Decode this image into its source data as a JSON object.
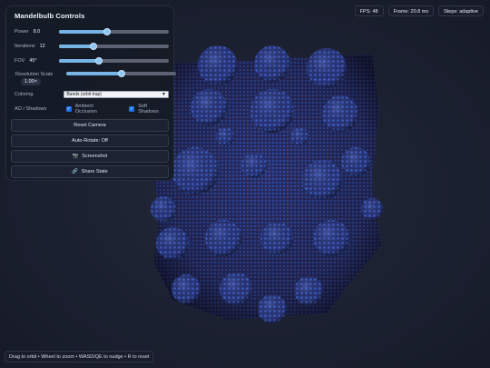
{
  "panel": {
    "title": "Mandelbulb Controls",
    "power": {
      "label": "Power",
      "value": "8.0",
      "fraction": 0.44
    },
    "iterations": {
      "label": "Iterations",
      "value": "12",
      "fraction": 0.31
    },
    "fov": {
      "label": "FOV",
      "value": "45°",
      "fraction": 0.36
    },
    "resolution": {
      "label": "Resolution Scale",
      "value": "1.00×",
      "fraction": 0.5
    },
    "coloring": {
      "label": "Coloring",
      "selected": "Bands (orbit trap)"
    },
    "ao_shadows": {
      "label": "AO / Shadows",
      "ambient_occlusion": {
        "label": "Ambient Occlusion",
        "checked": true
      },
      "soft_shadows": {
        "label": "Soft Shadows",
        "checked": true
      }
    },
    "buttons": {
      "reset_camera": "Reset Camera",
      "auto_rotate": "Auto-Rotate: Off",
      "screenshot": "Screenshot",
      "share_state": "Share State"
    }
  },
  "stats": {
    "fps": "FPS: 48",
    "frame": "Frame: 20.8 ms",
    "steps": "Steps: adaptive"
  },
  "hint": "Drag to orbit • Wheel to zoom • WASD/QE to nudge • R to reset",
  "colors": {
    "background": "#1b2030",
    "accent": "#77b4e6",
    "fractal_blue": "#2a3f8c",
    "fractal_red": "#5e1f3a"
  },
  "icons": {
    "screenshot": "camera-icon",
    "share": "link-icon"
  }
}
